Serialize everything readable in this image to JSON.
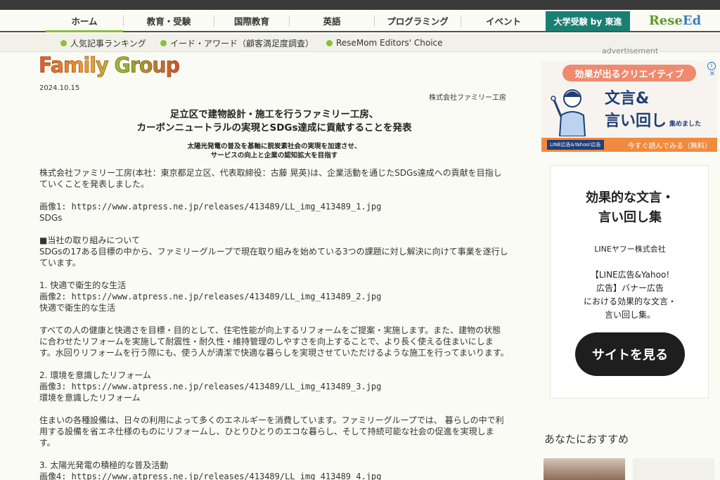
{
  "nav": {
    "items": [
      "ホーム",
      "教育・受験",
      "国際教育",
      "英語",
      "プログラミング",
      "イベント"
    ],
    "special": "大学受験 by 東進",
    "logo_main": "Rese",
    "logo_accent": "Ed"
  },
  "subnav": {
    "items": [
      "人気記事ランキング",
      "イード・アワード（顧客満足度調査）",
      "ReseMom Editors' Choice"
    ]
  },
  "logo_text": "Family Group",
  "article": {
    "date": "2024.10.15",
    "company": "株式会社ファミリー工房",
    "headline_1": "足立区で建物設計・施工を行うファミリー工房、",
    "headline_2": "カーボンニュートラルの実現とSDGs達成に貢献することを発表",
    "subhead_1": "太陽光発電の普及を基軸に脱炭素社会の実現を加速させ、",
    "subhead_2": "サービスの向上と企業の認知拡大を目指す",
    "p1": "株式会社ファミリー工房(本社：東京都足立区、代表取締役：古藤 晃英)は、企業活動を通じたSDGs達成への貢献を目指していくことを発表しました。",
    "img1": "画像1: https://www.atpress.ne.jp/releases/413489/LL_img_413489_1.jpg",
    "img1_caption": "SDGs",
    "section": "■当社の取り組みについて",
    "p2": "SDGsの17ある目標の中から、ファミリーグループで現在取り組みを始めている3つの課題に対し解決に向けて事業を遂行しています。",
    "h1": "1. 快適で衛生的な生活",
    "img2": "画像2: https://www.atpress.ne.jp/releases/413489/LL_img_413489_2.jpg",
    "img2_caption": "快適で衛生的な生活",
    "p3": "すべての人の健康と快適さを目標・目的として、住宅性能が向上するリフォームをご提案・実施します。また、建物の状態に合わせたリフォームを実施して耐震性・耐久性・維持管理のしやすさを向上することで、より長く使える住まいにします。水回りリフォームを行う際にも、使う人が清潔で快適な暮らしを実現させていただけるような施工を行ってまいります。",
    "h2": "2. 環境を意識したリフォーム",
    "img3": "画像3: https://www.atpress.ne.jp/releases/413489/LL_img_413489_3.jpg",
    "img3_caption": "環境を意識したリフォーム",
    "p4": "住まいの各種設備は、日々の利用によって多くのエネルギーを消費しています。ファミリーグループでは、 暮らしの中で利用する設備を省エネ仕様のものにリフォームし、ひとりひとりのエコな暮らし、そして持続可能な社会の促進を実現します。",
    "h3": "3. 太陽光発電の積極的な普及活動",
    "img4": "画像4: https://www.atpress.ne.jp/releases/413489/LL_img_413489_4.jpg"
  },
  "sidebar": {
    "ad_label": "advertisement",
    "banner": {
      "top": "効果が出るクリエイティブ",
      "line1": "文言&",
      "line2": "言い回し",
      "line2_small": "集めました",
      "foot_label": "LINE広告&Yahoo!広告",
      "foot_cta": "今すぐ読んでみる（無料）"
    },
    "card": {
      "title_1": "効果的な文言・",
      "title_2": "言い回し集",
      "company": "LINEヤフー株式会社",
      "desc_1": "【LINE広告&Yahoo!",
      "desc_2": "広告】バナー広告",
      "desc_3": "における効果的な文言・",
      "desc_4": "言い回し集。",
      "button": "サイトを見る"
    },
    "recommend_title": "あなたにおすすめ"
  },
  "colors": {
    "accent_green": "#8bbf3a",
    "special_teal": "#1a7f73",
    "banner_orange": "#f08a3e"
  }
}
